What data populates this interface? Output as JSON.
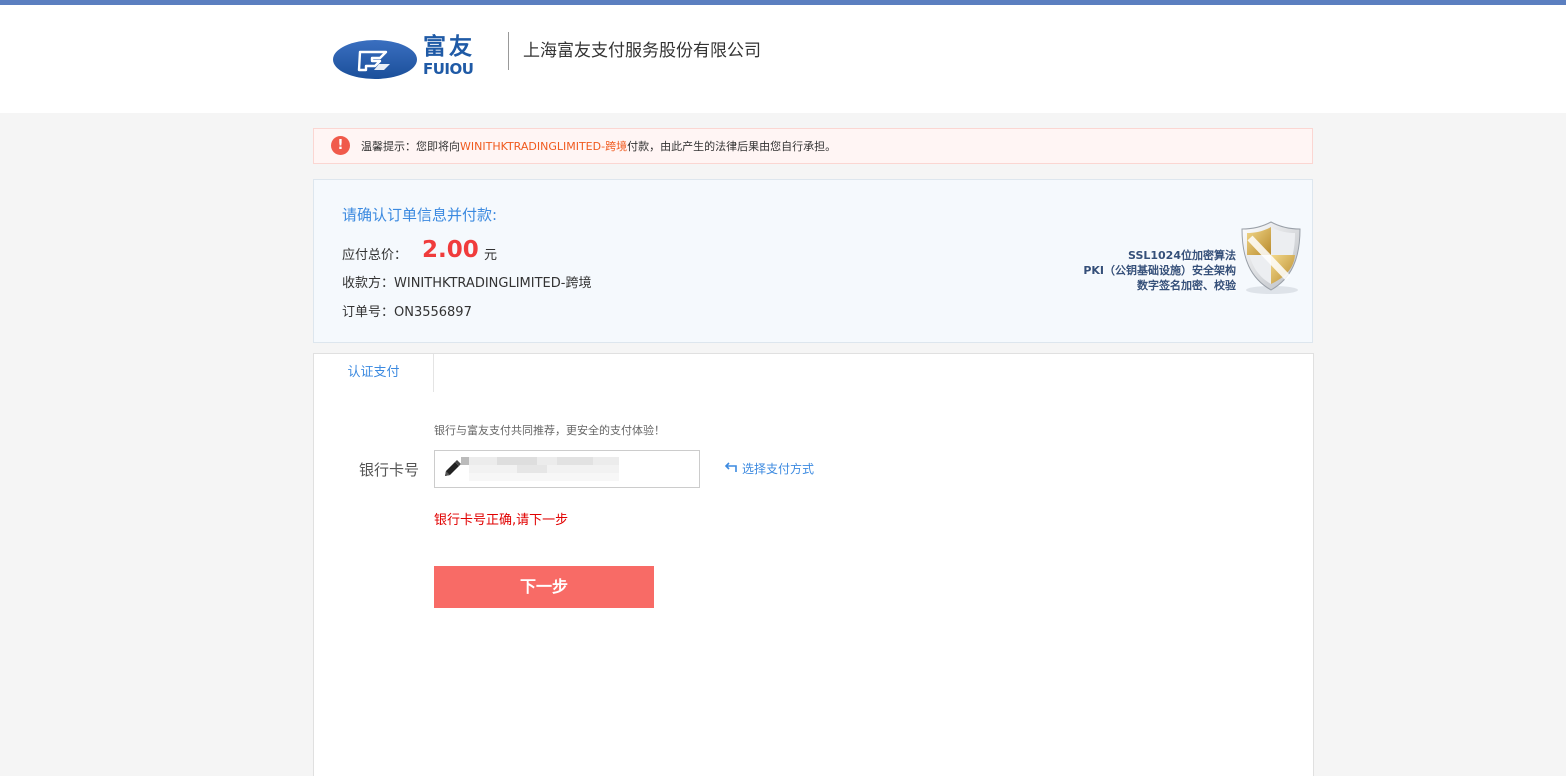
{
  "header": {
    "logo_cn": "富友",
    "logo_en": "FUIOU",
    "company_name": "上海富友支付服务股份有限公司"
  },
  "warning": {
    "prefix": "温馨提示：您即将向",
    "merchant": "WINITHKTRADINGLIMITED-跨境",
    "suffix": "付款，由此产生的法律后果由您自行承担。"
  },
  "order": {
    "title": "请确认订单信息并付款:",
    "amount_label": "应付总价：",
    "amount_value": "2.00",
    "amount_unit": "元",
    "payee": "收款方：WINITHKTRADINGLIMITED-跨境",
    "order_no": "订单号：ON3556897"
  },
  "security": {
    "line1": "SSL1024位加密算法",
    "line2": "PKI（公钥基础设施）安全架构",
    "line3": "数字签名加密、校验"
  },
  "payment": {
    "tab_label": "认证支付",
    "recommend": "银行与富友支付共同推荐，更安全的支付体验！",
    "card_label": "银行卡号",
    "switch_method": "选择支付方式",
    "validation_message": "银行卡号正确,请下一步",
    "next_button": "下一步"
  },
  "colors": {
    "accent_blue": "#3c8ae0",
    "amount_red": "#f03c3c",
    "button_red": "#f86b66",
    "top_bar": "#5b7fc0"
  },
  "icons": [
    "warning-icon",
    "pen-icon",
    "switch-icon",
    "shield-icon"
  ]
}
